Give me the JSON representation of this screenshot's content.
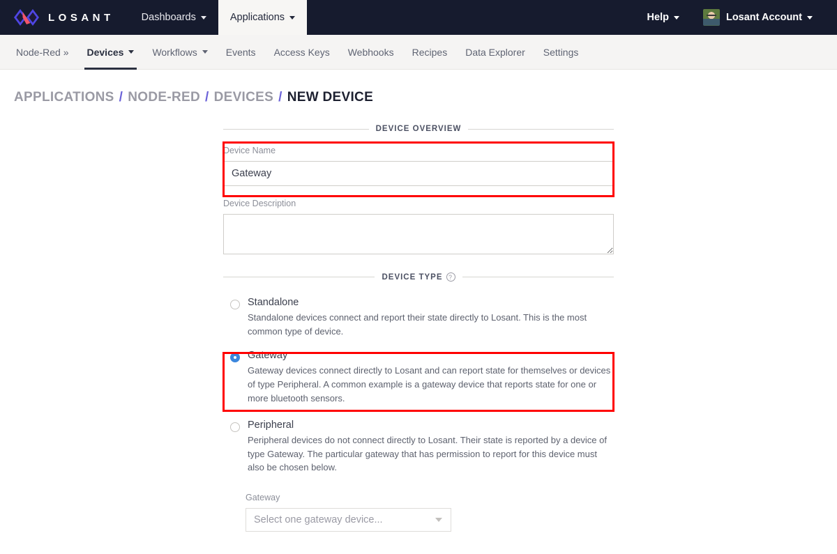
{
  "topbar": {
    "brand_name": "LOSANT",
    "brand_logo_icon": "losant-infinity-logo",
    "nav": [
      {
        "label": "Dashboards",
        "has_caret": true,
        "active": false
      },
      {
        "label": "Applications",
        "has_caret": true,
        "active": true
      }
    ],
    "help_label": "Help",
    "account_label": "Losant Account",
    "avatar_icon": "user-avatar",
    "background_color": "#161b2e"
  },
  "subnav": {
    "items": [
      {
        "label": "Node-Red »",
        "has_caret": false,
        "active": false,
        "strong": false
      },
      {
        "label": "Devices",
        "has_caret": true,
        "active": true,
        "strong": true
      },
      {
        "label": "Workflows",
        "has_caret": true,
        "active": false,
        "strong": false
      },
      {
        "label": "Events",
        "has_caret": false,
        "active": false,
        "strong": false
      },
      {
        "label": "Access Keys",
        "has_caret": false,
        "active": false,
        "strong": false
      },
      {
        "label": "Webhooks",
        "has_caret": false,
        "active": false,
        "strong": false
      },
      {
        "label": "Recipes",
        "has_caret": false,
        "active": false,
        "strong": false
      },
      {
        "label": "Data Explorer",
        "has_caret": false,
        "active": false,
        "strong": false
      },
      {
        "label": "Settings",
        "has_caret": false,
        "active": false,
        "strong": false
      }
    ],
    "background_color": "#f5f4f3"
  },
  "breadcrumb": {
    "separator": "/",
    "separator_color": "#6c63d8",
    "items": [
      {
        "label": "APPLICATIONS",
        "current": false
      },
      {
        "label": "NODE-RED",
        "current": false
      },
      {
        "label": "DEVICES",
        "current": false
      },
      {
        "label": "NEW DEVICE",
        "current": true
      }
    ]
  },
  "form": {
    "overview_section": {
      "title": "DEVICE OVERVIEW",
      "device_name": {
        "label": "Device Name",
        "value": "Gateway",
        "placeholder": ""
      },
      "device_description": {
        "label": "Device Description",
        "value": "",
        "placeholder": ""
      }
    },
    "device_type_section": {
      "title": "DEVICE TYPE",
      "help_icon": "question-mark-icon",
      "help_glyph": "?",
      "options": [
        {
          "id": "standalone",
          "title": "Standalone",
          "description": "Standalone devices connect and report their state directly to Losant. This is the most common type of device.",
          "selected": false
        },
        {
          "id": "gateway",
          "title": "Gateway",
          "description": "Gateway devices connect directly to Losant and can report state for themselves or devices of type Peripheral. A common example is a gateway device that reports state for one or more bluetooth sensors.",
          "selected": true
        },
        {
          "id": "peripheral",
          "title": "Peripheral",
          "description": "Peripheral devices do not connect directly to Losant. Their state is reported by a device of type Gateway. The particular gateway that has permission to report for this device must also be chosen below.",
          "selected": false
        }
      ],
      "gateway_select": {
        "label": "Gateway",
        "placeholder": "Select one gateway device...",
        "value": "",
        "disabled": true,
        "caret_icon": "chevron-down-icon"
      }
    }
  },
  "annotations": {
    "highlight_color": "#ff0000",
    "boxes": [
      {
        "name": "device-name-highlight"
      },
      {
        "name": "gateway-option-highlight"
      }
    ]
  }
}
